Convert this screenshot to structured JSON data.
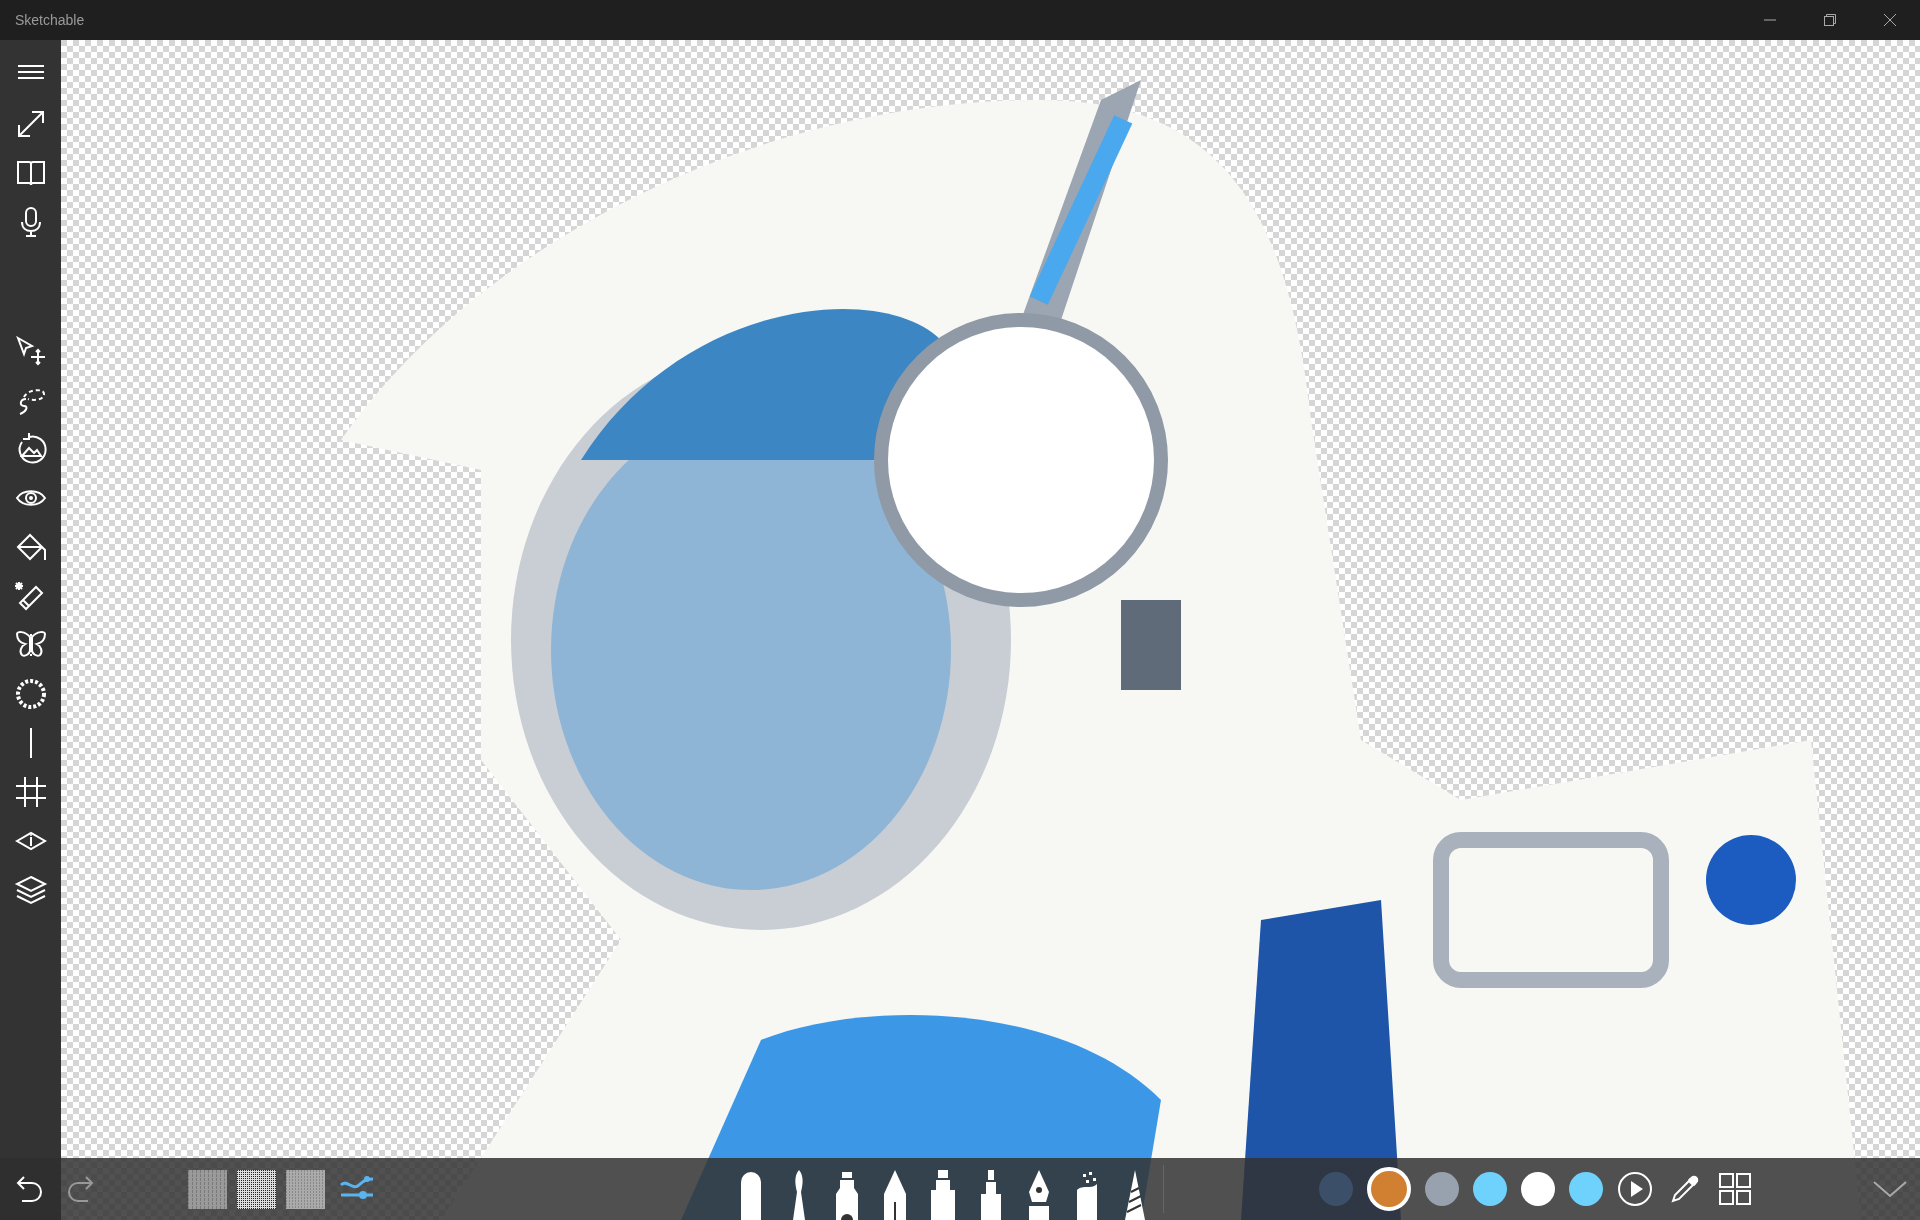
{
  "window": {
    "title": "Sketchable"
  },
  "palette": [
    {
      "color": "#3b5068",
      "selected": false
    },
    {
      "color": "#d08030",
      "selected": true
    },
    {
      "color": "#97a2ae",
      "selected": false
    },
    {
      "color": "#6fd2fc",
      "selected": false
    },
    {
      "color": "#ffffff",
      "selected": false
    },
    {
      "color": "#6fd2fc",
      "selected": false
    }
  ]
}
